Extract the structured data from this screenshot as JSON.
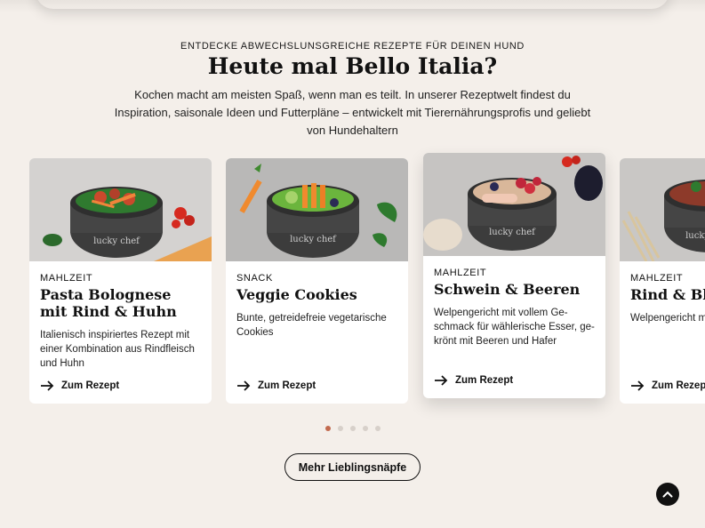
{
  "section": {
    "eyebrow": "ENTDECKE ABWECHSLUNSGREICHE REZEPTE FÜR DEINEN HUND",
    "headline": "Heute mal Bello Italia?",
    "intro": "Kochen macht am meisten Spaß, wenn man es teilt. In unserer Rezeptwelt findest du Inspiration, saisonale Ideen und Futterpläne – entwickelt mit Tierernährungsprofis und geliebt von Hundehaltern"
  },
  "cards": [
    {
      "category": "MAHLZEIT",
      "title": "Pasta Bolognese mit Rind & Huhn",
      "description": "Italienisch inspiriertes Rezept mit ei­ner Kombination aus Rindfleisch und Huhn",
      "cta": "Zum Rezept",
      "bowl_label": "lucky chef"
    },
    {
      "category": "SNACK",
      "title": "Veggie Cookies",
      "description": "Bunte, getreidefreie vegetarische Cookies",
      "cta": "Zum Rezept",
      "bowl_label": "lucky chef"
    },
    {
      "category": "MAHLZEIT",
      "title": "Schwein & Beeren",
      "description": "Welpengericht mit vollem Ge­schmack für wählerische Esser, ge­krönt mit Beeren und Hafer",
      "cta": "Zum Rezept",
      "bowl_label": "lucky chef"
    },
    {
      "category": "MAHLZEIT",
      "title": "Rind & Blau",
      "description": "Welpengericht mi und Rindfleisch",
      "cta": "Zum Rezept",
      "bowl_label": "lucky chef"
    }
  ],
  "carousel": {
    "page_count": 5,
    "active_index": 0
  },
  "more_button": "Mehr Lieblingsnäpfe",
  "icons": {
    "cta": "arrow-right-icon",
    "back_to_top": "chevron-up-icon"
  },
  "colors": {
    "background": "#f4efea",
    "accent_dot": "#c26a4f",
    "text": "#111111"
  }
}
